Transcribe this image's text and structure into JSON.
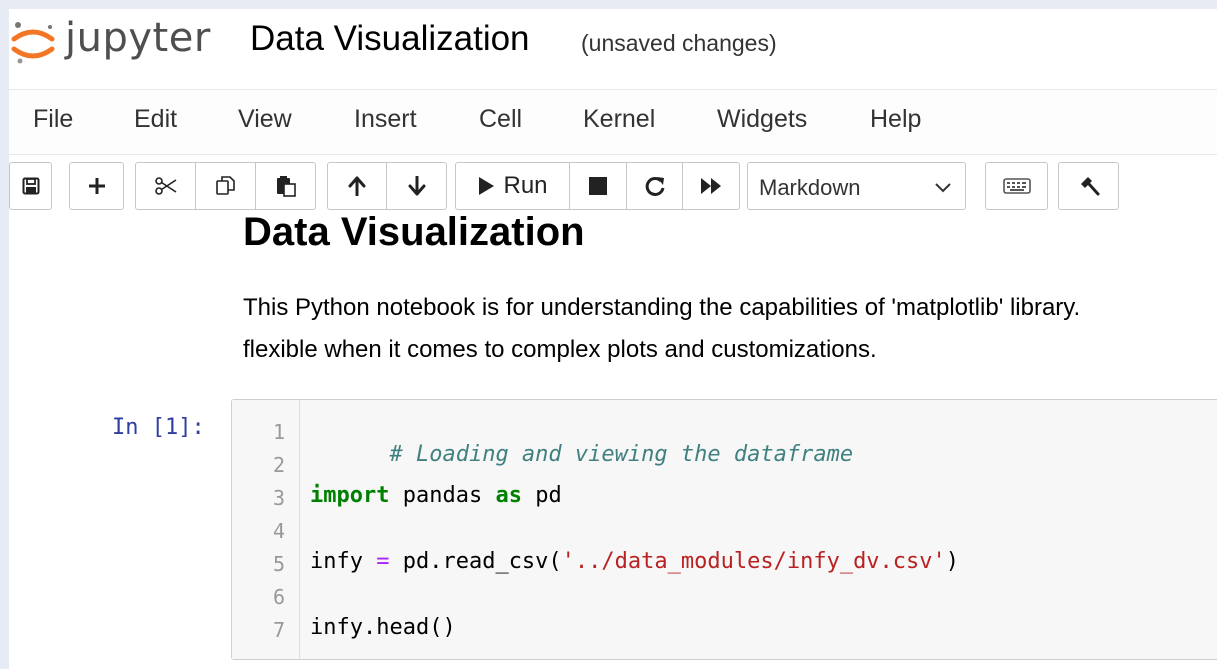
{
  "header": {
    "logo_text": "jupyter",
    "notebook_title": "Data Visualization",
    "save_status": "(unsaved changes)"
  },
  "menu": [
    "File",
    "Edit",
    "View",
    "Insert",
    "Cell",
    "Kernel",
    "Widgets",
    "Help"
  ],
  "toolbar": {
    "run_label": "Run",
    "cell_type": "Markdown",
    "icons": [
      "save-icon",
      "add-cell-icon",
      "cut-icon",
      "copy-icon",
      "paste-icon",
      "move-up-icon",
      "move-down-icon",
      "run-icon",
      "stop-icon",
      "restart-icon",
      "fast-forward-icon",
      "keyboard-icon",
      "command-palette-icon"
    ]
  },
  "markdown_cell": {
    "heading": "Data Visualization",
    "line1": "This Python notebook is for understanding the capabilities of 'matplotlib' library.",
    "line2": "flexible when it comes to complex plots and customizations."
  },
  "code_cell": {
    "prompt": "In [1]:",
    "line_numbers": [
      "1",
      "2",
      "3",
      "4",
      "5",
      "6",
      "7"
    ],
    "line1_comment": "# Loading and viewing the dataframe",
    "line3_kw1": "import",
    "line3_mod": " pandas ",
    "line3_kw2": "as",
    "line3_alias": " pd",
    "line5_var": "infy ",
    "line5_op": "=",
    "line5_call": " pd.read_csv(",
    "line5_str": "'../data_modules/infy_dv.csv'",
    "line5_close": ")",
    "line7": "infy.head()"
  }
}
